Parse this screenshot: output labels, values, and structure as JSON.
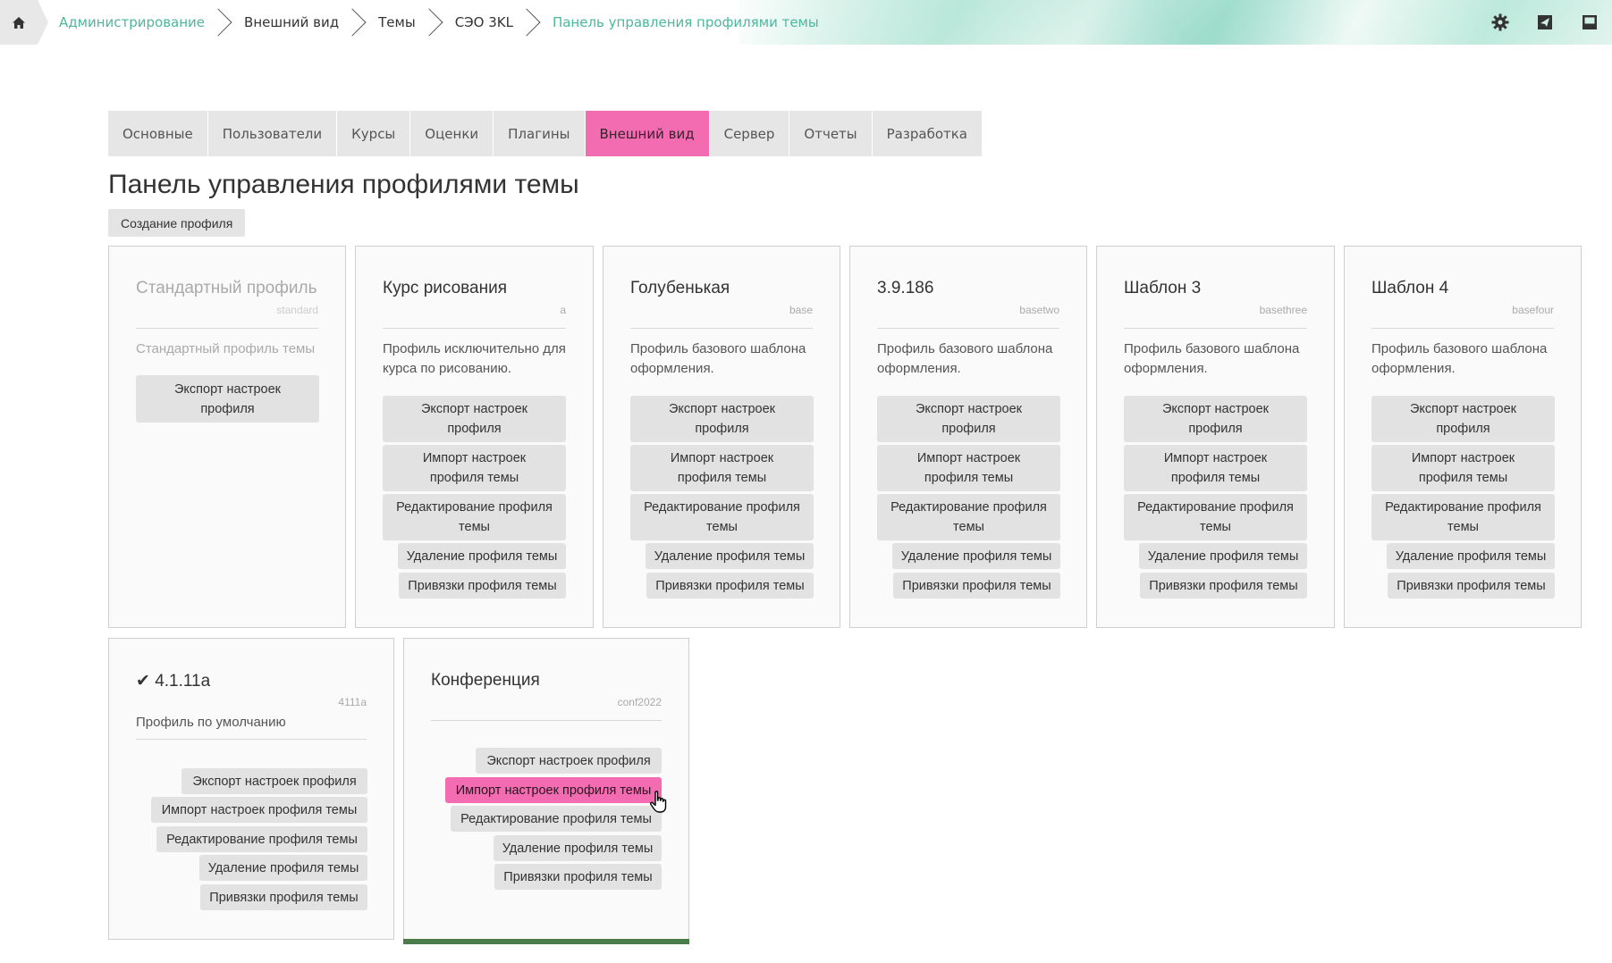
{
  "breadcrumb": {
    "items": [
      "Администрирование",
      "Внешний вид",
      "Темы",
      "СЭО 3KL",
      "Панель управления профилями темы"
    ]
  },
  "icons": {
    "home": "home-icon",
    "settings": "gear-icon",
    "messages": "send-icon",
    "notes": "inbox-icon"
  },
  "tabs": [
    "Основные",
    "Пользователи",
    "Курсы",
    "Оценки",
    "Плагины",
    "Внешний вид",
    "Сервер",
    "Отчеты",
    "Разработка"
  ],
  "active_tab": "Внешний вид",
  "page_title": "Панель управления профилями темы",
  "create_button": "Создание профиля",
  "profiles": [
    {
      "name": "Стандартный профиль",
      "code": "standard",
      "description": "Стандартный профиль темы",
      "buttons": [
        "Экспорт настроек профиля"
      ]
    },
    {
      "name": "Курс рисования",
      "code": "a",
      "description": "Профиль исключительно для курса по рисованию.",
      "buttons": [
        "Экспорт настроек профиля",
        "Импорт настроек профиля темы",
        "Редактирование профиля темы",
        "Удаление профиля темы",
        "Привязки профиля темы"
      ]
    },
    {
      "name": "Голубенькая",
      "code": "base",
      "description": "Профиль базового шаблона оформления.",
      "buttons": [
        "Экспорт настроек профиля",
        "Импорт настроек профиля темы",
        "Редактирование профиля темы",
        "Удаление профиля темы",
        "Привязки профиля темы"
      ]
    },
    {
      "name": "3.9.186",
      "code": "basetwo",
      "description": "Профиль базового шаблона оформления.",
      "buttons": [
        "Экспорт настроек профиля",
        "Импорт настроек профиля темы",
        "Редактирование профиля темы",
        "Удаление профиля темы",
        "Привязки профиля темы"
      ]
    },
    {
      "name": "Шаблон 3",
      "code": "basethree",
      "description": "Профиль базового шаблона оформления.",
      "buttons": [
        "Экспорт настроек профиля",
        "Импорт настроек профиля темы",
        "Редактирование профиля темы",
        "Удаление профиля темы",
        "Привязки профиля темы"
      ]
    },
    {
      "name": "Шаблон 4",
      "code": "basefour",
      "description": "Профиль базового шаблона оформления.",
      "buttons": [
        "Экспорт настроек профиля",
        "Импорт настроек профиля темы",
        "Редактирование профиля темы",
        "Удаление профиля темы",
        "Привязки профиля темы"
      ]
    },
    {
      "name": "✔ 4.1.11a",
      "code": "4111a",
      "description": "Профиль по умолчанию",
      "buttons": [
        "Экспорт настроек профиля",
        "Импорт настроек профиля темы",
        "Редактирование профиля темы",
        "Удаление профиля темы",
        "Привязки профиля темы"
      ]
    },
    {
      "name": "Конференция",
      "code": "conf2022",
      "description": "",
      "buttons": [
        "Экспорт настроек профиля",
        "Импорт настроек профиля темы",
        "Редактирование профиля темы",
        "Удаление профиля темы",
        "Привязки профиля темы"
      ]
    }
  ],
  "colors": {
    "accent": "#f36bb0",
    "link": "#4cb89a",
    "tab_bg": "#e6e6e6",
    "button_bg": "#e2e2e2",
    "progress": "#4a7c4a"
  }
}
